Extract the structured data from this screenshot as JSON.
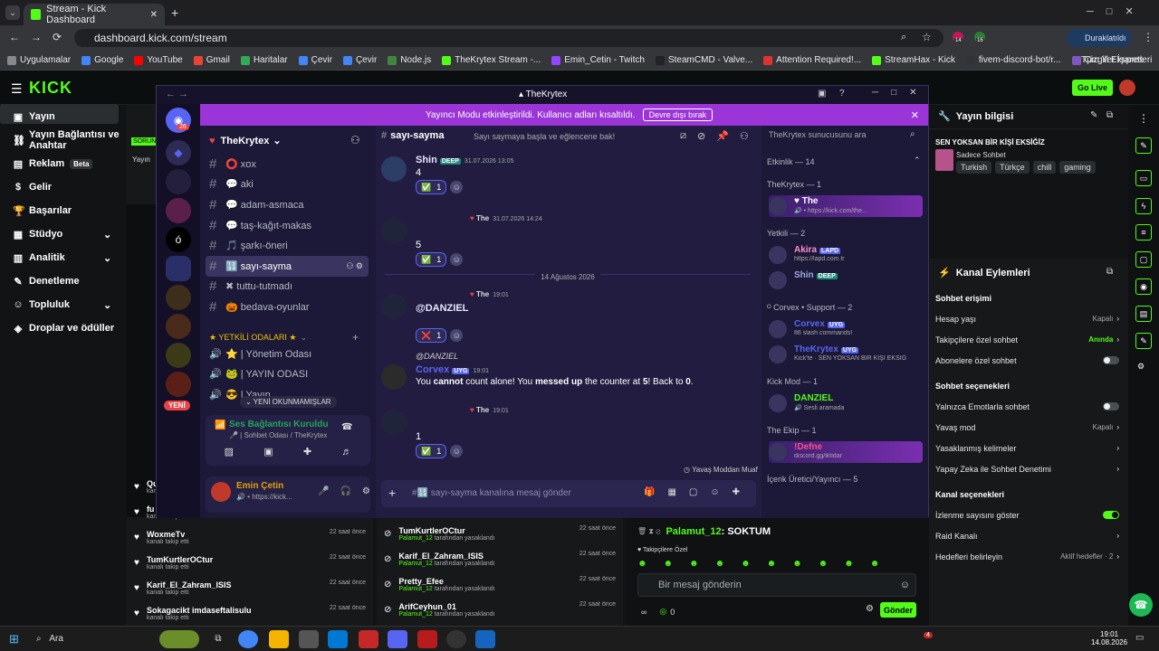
{
  "browser": {
    "tab_title": "Stream - Kick Dashboard",
    "url": "dashboard.kick.com/stream",
    "profile": "Duraklatıldı",
    "bookmarks": [
      "Uygulamalar",
      "Google",
      "YouTube",
      "Gmail",
      "Haritalar",
      "Çevir",
      "Çevir",
      "Node.js",
      "TheKrytex Stream -...",
      "Emin_Cetin - Twitch",
      "SteamCMD - Valve...",
      "Attention Required!...",
      "StreamHax - Kick",
      "fivem-discord-bot/r...",
      "Çizgili Ekspres"
    ],
    "all_bookmarks": "Tüm Yer İşaretleri",
    "ext_badges": [
      "14",
      "16"
    ]
  },
  "kick": {
    "go_live": "Go Live",
    "nav": [
      {
        "label": "Yayın",
        "icon": "▣"
      },
      {
        "label": "Yayın Bağlantısı ve Anahtar",
        "icon": "⛓"
      },
      {
        "label": "Reklam",
        "icon": "▤",
        "badge": "Beta"
      },
      {
        "label": "Gelir",
        "icon": "$"
      },
      {
        "label": "Başarılar",
        "icon": "🏆"
      },
      {
        "label": "Stüdyo",
        "icon": "▦",
        "chevron": "⌄"
      },
      {
        "label": "Analitik",
        "icon": "▥",
        "chevron": "⌄"
      },
      {
        "label": "Denetleme",
        "icon": "✎"
      },
      {
        "label": "Topluluk",
        "icon": "☺",
        "chevron": "⌄"
      },
      {
        "label": "Droplar ve ödüller",
        "icon": "◈"
      }
    ],
    "preview_tag": "SORUN",
    "preview_label": "Yayın",
    "stream_info": {
      "title": "Yayın bilgisi",
      "stream_title": "SEN YOKSAN BİR KİŞİ EKSİĞİZ",
      "category": "Sadece Sohbet",
      "tags": [
        "Turkish",
        "Türkçe",
        "chill",
        "gaming"
      ]
    },
    "actions": {
      "title": "Kanal Eylemleri",
      "chat_access": "Sohbet erişimi",
      "rows1": [
        {
          "label": "Hesap yaşı",
          "value": "Kapalı"
        },
        {
          "label": "Takipçilere özel sohbet",
          "value": "Anında",
          "accent": true
        },
        {
          "label": "Abonelere özel sohbet",
          "toggle": false
        }
      ],
      "chat_options": "Sohbet seçenekleri",
      "rows2": [
        {
          "label": "Yalnızca Emotlarla sohbet",
          "toggle": false
        },
        {
          "label": "Yavaş mod",
          "value": "Kapalı"
        },
        {
          "label": "Yasaklanmış kelimeler"
        },
        {
          "label": "Yapay Zeka ile Sohbet Denetimi"
        }
      ],
      "channel_options": "Kanal seçenekleri",
      "rows3": [
        {
          "label": "İzlenme sayısını göster",
          "toggle": true
        },
        {
          "label": "Raid Kanalı"
        },
        {
          "label": "Hedefleri belirleyin",
          "value": "Aktif hedefler · 2"
        }
      ]
    },
    "followers": [
      {
        "name": "Qu",
        "sub": "kanalı takip etti",
        "time": ""
      },
      {
        "name": "fu",
        "sub": "kanalı takip etti",
        "time": ""
      },
      {
        "name": "WoxmeTv",
        "sub": "kanalı takip etti",
        "time": "22 saat önce"
      },
      {
        "name": "TumKurtlerOCtur",
        "sub": "kanalı takip etti",
        "time": "22 saat önce"
      },
      {
        "name": "Karif_El_Zahram_ISIS",
        "sub": "kanalı takip etti",
        "time": "22 saat önce"
      },
      {
        "name": "Sokagacikt imdaseftalisulu",
        "sub": "kanalı takip etti",
        "time": "22 saat önce"
      }
    ],
    "bans": [
      {
        "name": "TumKurtlerOCtur",
        "by": "Palamut_12",
        "sub": "tarafından yasaklandı",
        "time": "22 saat önce"
      },
      {
        "name": "Karif_El_Zahram_ISIS",
        "by": "Palamut_12",
        "sub": "tarafından yasaklandı",
        "time": "22 saat önce"
      },
      {
        "name": "Pretty_Efee",
        "by": "Palamut_12",
        "sub": "tarafından yasaklandı",
        "time": "22 saat önce"
      },
      {
        "name": "ArifCeyhun_01",
        "by": "Palamut_12",
        "sub": "tarafından yasaklandı",
        "time": "22 saat önce"
      }
    ],
    "chat": {
      "user": "Palamut_12",
      "text": ": SOKTUM",
      "note": "Takipçilere Özel",
      "placeholder": "Bir mesaj gönderin",
      "send": "Gönder",
      "count": "0"
    }
  },
  "discord": {
    "window_title": "TheKrytex",
    "banner": "Yayıncı Modu etkinleştirildi. Kullanıcı adları kısaltıldı.",
    "banner_btn": "Devre dışı bırak",
    "server": "TheKrytex",
    "server_badge": "26",
    "channels": [
      {
        "name": "⭕ xox"
      },
      {
        "name": "💬 aki"
      },
      {
        "name": "💬 adam-asmaca"
      },
      {
        "name": "💬 taş-kağıt-makas"
      },
      {
        "name": "🎵 şarkı-öneri"
      },
      {
        "name": "🔢 sayı-sayma",
        "selected": true
      },
      {
        "name": "✖ tuttu-tutmadı"
      },
      {
        "name": "🎃 bedava-oyunlar"
      }
    ],
    "category": "★ YETKİLİ ODALARI ★",
    "voice": [
      {
        "name": "⭐ | Yönetim Odası"
      },
      {
        "name": "🐸 | YAYIN ODASI"
      },
      {
        "name": "😎 | Yayın"
      }
    ],
    "unread": "YENİ OKUNMAMIŞLAR",
    "new_label": "YENİ",
    "voice_status": "Ses Bağlantısı Kuruldu",
    "voice_channel": "🎤 | Sohbet Odası / TheKrytex",
    "user": "Emin Çetin",
    "user_status": "https://kick...",
    "channel_header": "sayı-sayma",
    "channel_topic": "Sayı saymaya başla ve eğlencene bak!",
    "search": "TheKrytex sunucusunu ara",
    "messages": [
      {
        "user": "Shin",
        "tag": "DEEP",
        "time": "31.07.2026 13:05",
        "body": "4",
        "react": "✅",
        "count": "1"
      },
      {
        "user": "",
        "reply": "The",
        "time": "31.07.2026 14:24",
        "body": "5",
        "react": "✅",
        "count": "1"
      },
      {
        "user": "@DANZIEL",
        "reply": "The",
        "time": "19:01",
        "body": "",
        "react": "❌",
        "count": "1"
      },
      {
        "user": "Corvex",
        "tag": "UYG",
        "reply_to": "@DANZIEL",
        "time": "19:01",
        "body_parts": [
          "You ",
          "cannot",
          " count alone! You ",
          "messed up",
          " the counter at ",
          "5",
          "! Back to ",
          "0",
          "."
        ]
      },
      {
        "user": "",
        "reply": "The",
        "time": "19:01",
        "body": "1",
        "react": "✅",
        "count": "1"
      }
    ],
    "date_divider": "14 Ağustos 2026",
    "slowmode": "Yavaş Moddan Muaf",
    "input_placeholder": "#🔢 sayı-sayma kanalına mesaj gönder",
    "members": {
      "activity": "Etkinlik — 14",
      "groups": [
        {
          "title": "TheKrytex — 1",
          "members": [
            {
              "name": "♥ The",
              "status": "🔊 • https://kick.com/the..."
            }
          ]
        },
        {
          "title": "Yetkili — 2",
          "members": [
            {
              "name": "Akira",
              "tag": "LAPD",
              "status": "https://lapd.com.tr"
            },
            {
              "name": "Shin",
              "tag": "DEEP",
              "status": ""
            }
          ]
        },
        {
          "title": "ᴼ Corvex • Support — 2",
          "members": [
            {
              "name": "Corvex",
              "tag": "UYG",
              "status": "86 slash commands!"
            },
            {
              "name": "TheKrytex",
              "tag": "UYG",
              "status": "Kick'te · SEN YOKSAN BİR KİŞİ EKSİĞ"
            }
          ]
        },
        {
          "title": "Kick Mod — 1",
          "members": [
            {
              "name": "DANZIEL",
              "status": "🔊 Sesli aramada"
            }
          ]
        },
        {
          "title": "The Ekip — 1",
          "members": [
            {
              "name": "!Defne",
              "status": "discord.gg/iktidar"
            }
          ]
        },
        {
          "title": "İçerik Üretici/Yayıncı — 5",
          "members": []
        }
      ]
    }
  },
  "taskbar": {
    "search": "Ara",
    "time": "19:01",
    "date": "14.08.2026",
    "badge": "4"
  },
  "colors": {
    "kick_green": "#53fc18",
    "discord_purple": "#9b35d8",
    "blurple": "#5865f2"
  }
}
